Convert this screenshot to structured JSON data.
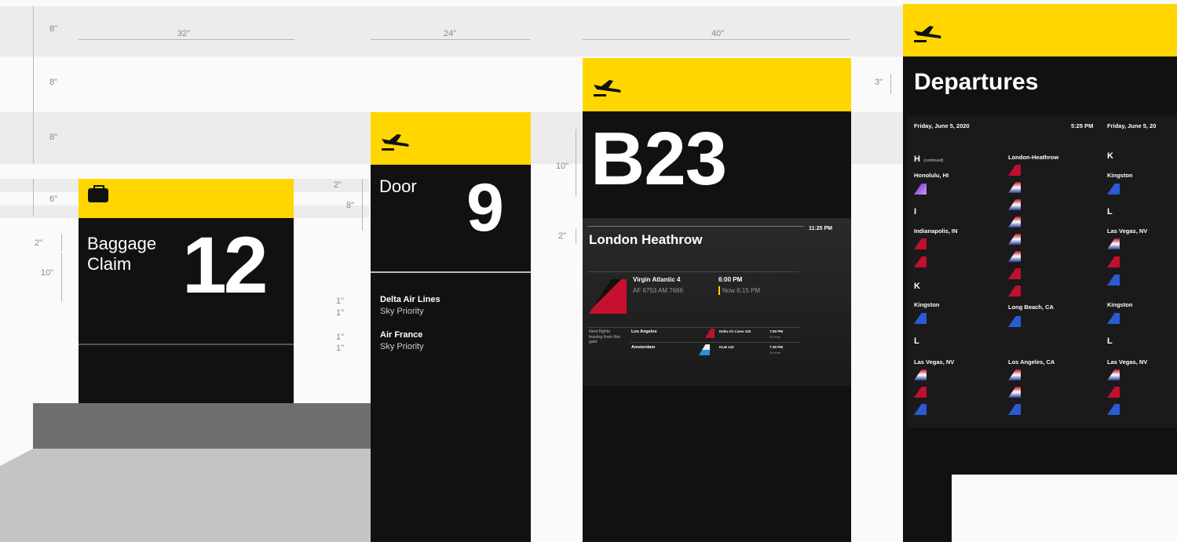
{
  "dimensions": {
    "row_8a": "8\"",
    "row_8b": "8\"",
    "row_8c": "8\"",
    "row_6": "6\"",
    "width_32": "32\"",
    "width_24": "24\"",
    "width_40": "40\"",
    "baggage_2": "2\"",
    "baggage_10": "10\"",
    "door_2": "2\"",
    "door_8": "8\"",
    "door_1a": "1\"",
    "door_1b": "1\"",
    "door_1c": "1\"",
    "door_1d": "1\"",
    "gate_10": "10\"",
    "gate_2": "2\"",
    "departures_3": "3\""
  },
  "baggage_sign": {
    "label_line1": "Baggage",
    "label_line2": "Claim",
    "number": "12"
  },
  "door_sign": {
    "label": "Door",
    "number": "9",
    "airline1_name": "Delta Air Lines",
    "airline1_sub": "Sky Priority",
    "airline2_name": "Air France",
    "airline2_sub": "Sky Priority"
  },
  "gate_sign": {
    "gate": "B23",
    "destination": "London Heathrow",
    "time_now": "11:25 PM",
    "flight_name": "Virgin Atlantic 4",
    "codeshare": "AF 6753  AM 7666",
    "scheduled": "6:00 PM",
    "status": "Now 6:15 PM",
    "next_label": "Next flights leaving from this gate",
    "next_flights": [
      {
        "city": "Los Angeles",
        "flight": "Delta Air Lines 120",
        "time": "7:00 PM",
        "status": "On time"
      },
      {
        "city": "Amsterdam",
        "flight": "KLM 133",
        "time": "7:30 PM",
        "status": "On time"
      }
    ]
  },
  "departures": {
    "title": "Departures",
    "date": "Friday, June 5, 2020",
    "time": "5:25 PM",
    "date2": "Friday, June 5, 20",
    "col1": {
      "h_label": "H",
      "h_sub": "(continued)",
      "city1": "Honolulu, HI",
      "i_label": "I",
      "city2": "Indianapolis, IN",
      "k_label": "K",
      "city3": "Kingston",
      "l_label": "L",
      "city4": "Las Vegas, NV"
    },
    "col2": {
      "city1": "London-Heathrow",
      "city2": "Long Beach, CA",
      "city3": "Los Angeles, CA"
    },
    "col3": {
      "k_label": "K",
      "city1": "Kingston",
      "l_label": "L",
      "city2": "Las Vegas, NV",
      "city3": "Kingston",
      "l2_label": "L",
      "city4": "Las Vegas, NV"
    }
  },
  "icons": {
    "plane": "departing-plane-icon",
    "baggage": "baggage-icon"
  },
  "colors": {
    "accent": "#ffd600",
    "panel": "#111111",
    "band": "#ececec"
  }
}
